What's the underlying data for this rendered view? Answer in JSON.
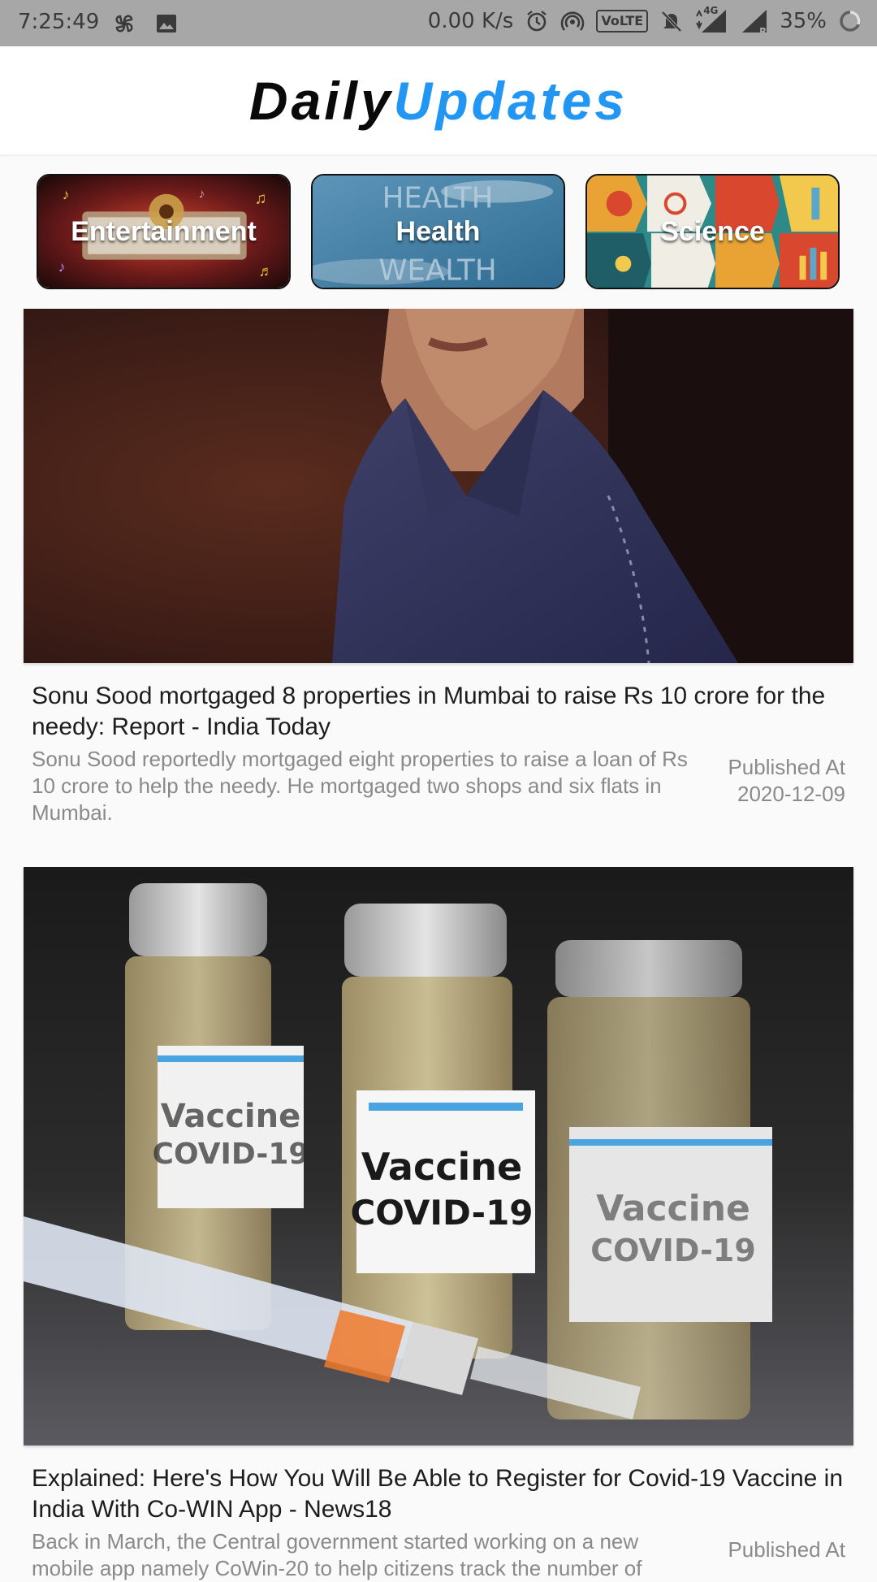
{
  "status_bar": {
    "time": "7:25:49",
    "speed": "0.00 K/s",
    "network": "4G",
    "volte": "VoLTE",
    "roaming": "R",
    "battery": "35%",
    "icons": [
      "pinwheel-icon",
      "image-icon",
      "alarm-icon",
      "hotspot-icon",
      "volte-icon",
      "mute-icon",
      "signal-4g-icon",
      "signal-icon",
      "battery-icon"
    ]
  },
  "app_bar": {
    "title_part1": "Daily",
    "title_part2": "Updates",
    "accent_color": "#2196f3"
  },
  "categories": [
    {
      "label": "Entertainment"
    },
    {
      "label": "Health",
      "image_text_1": "HEALTH",
      "image_text_2": "WEALTH"
    },
    {
      "label": "Science"
    }
  ],
  "articles": [
    {
      "title": "Sonu Sood mortgaged 8 properties in Mumbai to raise Rs 10 crore for the needy: Report - India Today",
      "description": "Sonu Sood reportedly mortgaged eight properties to raise a loan of Rs 10 crore to help the needy. He mortgaged two shops and six flats in Mumbai.",
      "published_label": "Published At",
      "published_date": "2020-12-09"
    },
    {
      "title": "Explained: Here's How You Will Be Able to Register for Covid-19 Vaccine in India With Co-WIN App - News18",
      "description": "Back in March, the Central government started working on a new mobile app namely CoWin-20 to help citizens track the number of",
      "published_label": "Published At",
      "published_date": "",
      "image_vial_line1": "Vaccine",
      "image_vial_line2": "COVID-19"
    }
  ]
}
